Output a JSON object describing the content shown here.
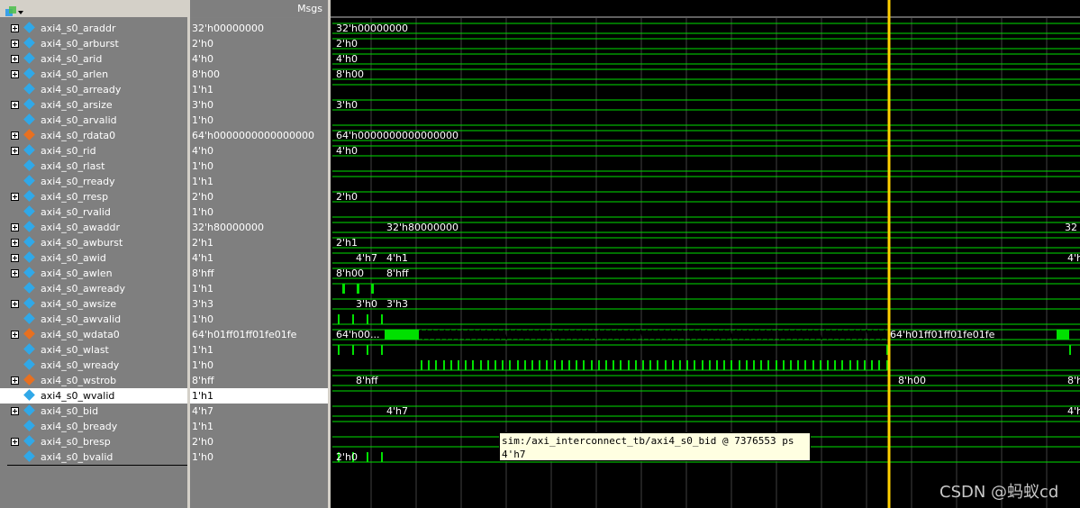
{
  "header": {
    "msgs_label": "Msgs"
  },
  "signals": [
    {
      "name": "axi4_s0_araddr",
      "value": "32'h00000000",
      "bus": true,
      "icon": "diamond-blue"
    },
    {
      "name": "axi4_s0_arburst",
      "value": "2'h0",
      "bus": true,
      "icon": "diamond-blue"
    },
    {
      "name": "axi4_s0_arid",
      "value": "4'h0",
      "bus": true,
      "icon": "diamond-blue"
    },
    {
      "name": "axi4_s0_arlen",
      "value": "8'h00",
      "bus": true,
      "icon": "diamond-blue"
    },
    {
      "name": "axi4_s0_arready",
      "value": "1'h1",
      "bus": false,
      "icon": "diamond-blue"
    },
    {
      "name": "axi4_s0_arsize",
      "value": "3'h0",
      "bus": true,
      "icon": "diamond-blue"
    },
    {
      "name": "axi4_s0_arvalid",
      "value": "1'h0",
      "bus": false,
      "icon": "diamond-blue"
    },
    {
      "name": "axi4_s0_rdata0",
      "value": "64'h0000000000000000",
      "bus": true,
      "icon": "diamond-orange"
    },
    {
      "name": "axi4_s0_rid",
      "value": "4'h0",
      "bus": true,
      "icon": "diamond-blue"
    },
    {
      "name": "axi4_s0_rlast",
      "value": "1'h0",
      "bus": false,
      "icon": "diamond-blue"
    },
    {
      "name": "axi4_s0_rready",
      "value": "1'h1",
      "bus": false,
      "icon": "diamond-blue"
    },
    {
      "name": "axi4_s0_rresp",
      "value": "2'h0",
      "bus": true,
      "icon": "diamond-blue"
    },
    {
      "name": "axi4_s0_rvalid",
      "value": "1'h0",
      "bus": false,
      "icon": "diamond-blue"
    },
    {
      "name": "axi4_s0_awaddr",
      "value": "32'h80000000",
      "bus": true,
      "icon": "diamond-blue"
    },
    {
      "name": "axi4_s0_awburst",
      "value": "2'h1",
      "bus": true,
      "icon": "diamond-blue"
    },
    {
      "name": "axi4_s0_awid",
      "value": "4'h1",
      "bus": true,
      "icon": "diamond-blue"
    },
    {
      "name": "axi4_s0_awlen",
      "value": "8'hff",
      "bus": true,
      "icon": "diamond-blue"
    },
    {
      "name": "axi4_s0_awready",
      "value": "1'h1",
      "bus": false,
      "icon": "diamond-blue"
    },
    {
      "name": "axi4_s0_awsize",
      "value": "3'h3",
      "bus": true,
      "icon": "diamond-blue"
    },
    {
      "name": "axi4_s0_awvalid",
      "value": "1'h0",
      "bus": false,
      "icon": "diamond-blue"
    },
    {
      "name": "axi4_s0_wdata0",
      "value": "64'h01ff01ff01fe01fe",
      "bus": true,
      "icon": "diamond-orange"
    },
    {
      "name": "axi4_s0_wlast",
      "value": "1'h1",
      "bus": false,
      "icon": "diamond-blue"
    },
    {
      "name": "axi4_s0_wready",
      "value": "1'h0",
      "bus": false,
      "icon": "diamond-blue"
    },
    {
      "name": "axi4_s0_wstrob",
      "value": "8'hff",
      "bus": true,
      "icon": "diamond-orange"
    },
    {
      "name": "axi4_s0_wvalid",
      "value": "1'h1",
      "bus": false,
      "icon": "diamond-blue",
      "selected": true
    },
    {
      "name": "axi4_s0_bid",
      "value": "4'h7",
      "bus": true,
      "icon": "diamond-blue"
    },
    {
      "name": "axi4_s0_bready",
      "value": "1'h1",
      "bus": false,
      "icon": "diamond-blue"
    },
    {
      "name": "axi4_s0_bresp",
      "value": "2'h0",
      "bus": true,
      "icon": "diamond-blue"
    },
    {
      "name": "axi4_s0_bvalid",
      "value": "1'h0",
      "bus": false,
      "icon": "diamond-blue"
    }
  ],
  "wave_labels": [
    {
      "row": 0,
      "text": "32'h00000000"
    },
    {
      "row": 1,
      "text": "2'h0"
    },
    {
      "row": 2,
      "text": "4'h0"
    },
    {
      "row": 3,
      "text": "8'h00"
    },
    {
      "row": 5,
      "text": "3'h0"
    },
    {
      "row": 7,
      "text": "64'h0000000000000000"
    },
    {
      "row": 8,
      "text": "4'h0"
    },
    {
      "row": 11,
      "text": "2'h0"
    },
    {
      "row": 13,
      "text": "32'h80000000"
    },
    {
      "row": 13,
      "text": "32"
    },
    {
      "row": 14,
      "text": "2'h1"
    },
    {
      "row": 15,
      "text": "4'h7"
    },
    {
      "row": 15,
      "text": "4'h1"
    },
    {
      "row": 15,
      "text": "4'h"
    },
    {
      "row": 16,
      "text": "8'h00"
    },
    {
      "row": 16,
      "text": "8'hff"
    },
    {
      "row": 18,
      "text": "3'h0"
    },
    {
      "row": 18,
      "text": "3'h3"
    },
    {
      "row": 20,
      "text": "64'h00..."
    },
    {
      "row": 20,
      "text": "64'h01ff01ff01fe01fe"
    },
    {
      "row": 23,
      "text": "8'hff"
    },
    {
      "row": 23,
      "text": "8'h00"
    },
    {
      "row": 23,
      "text": "8'h"
    },
    {
      "row": 25,
      "text": "4'h7"
    },
    {
      "row": 25,
      "text": "4'h"
    },
    {
      "row": 28,
      "text": "2'h0"
    }
  ],
  "tooltip": {
    "line1": "sim:/axi_interconnect_tb/axi4_s0_bid @ 7376553 ps",
    "line2": "4'h7"
  },
  "watermark": "CSDN @蚂蚁cd",
  "colors": {
    "wave": "#00e000",
    "cursor": "#ffd000",
    "grid": "#404040",
    "panel": "#7f7f7f"
  }
}
